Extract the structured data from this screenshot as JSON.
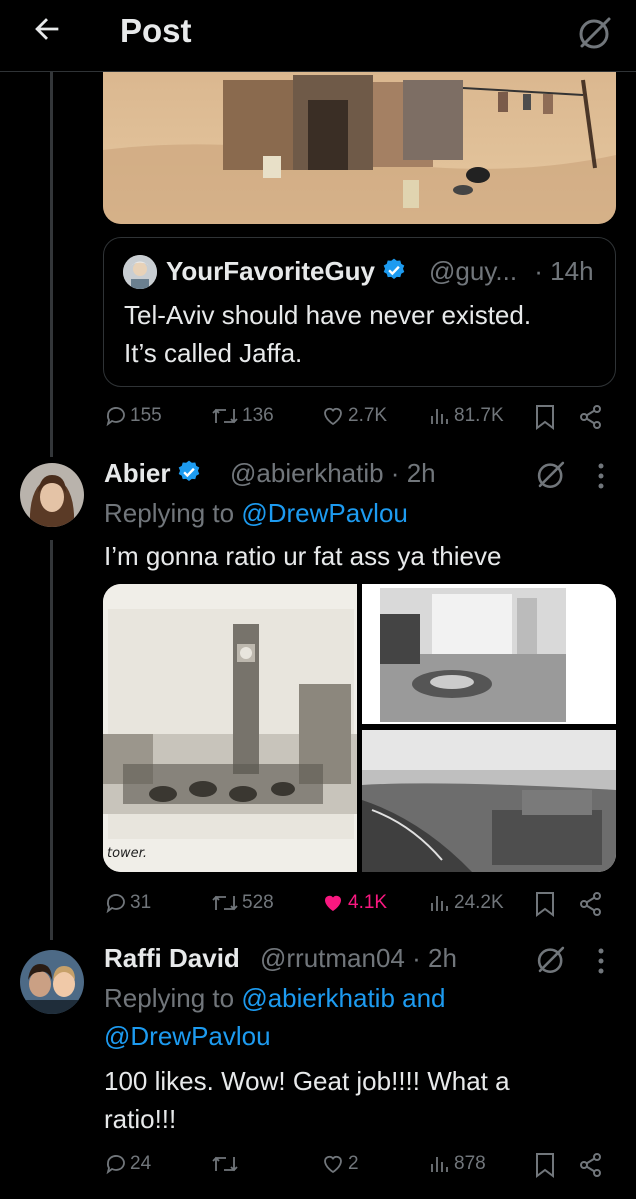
{
  "header": {
    "title": "Post"
  },
  "quoted_post": {
    "author_name": "YourFavoriteGuy",
    "handle": "@guy...",
    "time": "· 14h",
    "text_line1": "Tel-Aviv should have never existed.",
    "text_line2": "It’s called Jaffa."
  },
  "post1_actions": {
    "replies": "155",
    "reposts": "136",
    "likes": "2.7K",
    "views": "81.7K"
  },
  "post2": {
    "author_name": "Abier",
    "handle": "@abierkhatib · 2h",
    "replying_prefix": "Replying to",
    "replying_to": "@DrewPavlou",
    "text": "I’m gonna ratio ur fat ass ya thieve",
    "image1_caption": "tower.",
    "actions": {
      "replies": "31",
      "reposts": "528",
      "likes": "4.1K",
      "views": "24.2K"
    }
  },
  "post3": {
    "author_name": "Raffi David",
    "handle": "@rrutman04 · 2h",
    "replying_prefix": "Replying to",
    "replying_to_line1": "@abierkhatib and",
    "replying_to_line2": "@DrewPavlou",
    "text_line1": "100 likes. Wow! Geat job!!!! What a",
    "text_line2": "ratio!!!",
    "actions": {
      "replies": "24",
      "reposts": "",
      "likes": "2",
      "views": "878"
    }
  },
  "colors": {
    "background": "#000000",
    "text": "#e7e9ea",
    "muted": "#71767b",
    "link": "#1d9bf0",
    "like_active": "#f91880",
    "border": "#2f3336"
  }
}
